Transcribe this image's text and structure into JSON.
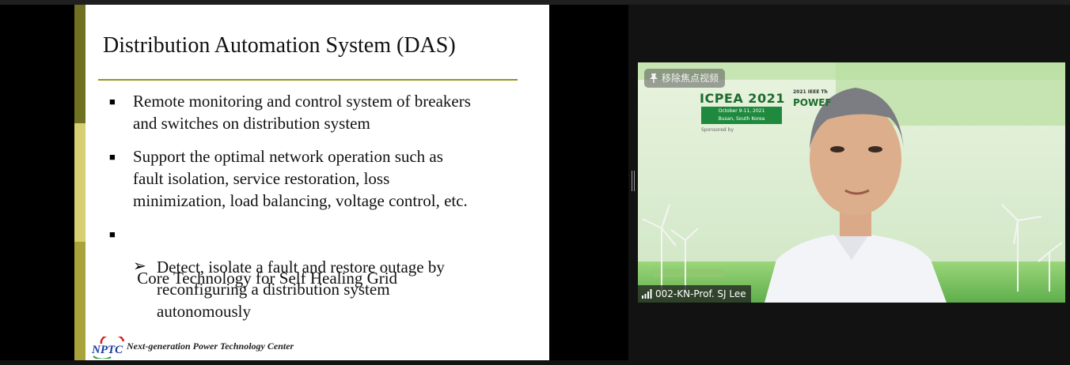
{
  "slide": {
    "title": "Distribution Automation System (DAS)",
    "bullets": [
      {
        "lines": [
          "Remote monitoring and control system of breakers",
          "and switches on distribution system"
        ]
      },
      {
        "lines": [
          "Support the optimal network operation such as",
          "fault isolation, service restoration, loss",
          "minimization, load balancing, voltage control, etc."
        ]
      },
      {
        "lines": [
          " Core Technology for Self Healing Grid"
        ]
      }
    ],
    "subbullet": {
      "lines": [
        "Detect, isolate a fault and restore outage by",
        "reconfiguring a distribution system",
        "autonomously"
      ]
    },
    "footer_text": "Next-generation Power Technology Center",
    "logo_text": "NPTC",
    "bullet_glyph": "■",
    "arrow_glyph": "➢",
    "colors": {
      "stripe_dark": "#6f7022",
      "stripe_light": "#d6cf74",
      "stripe_mid": "#a8a33a",
      "rule": "#9a9420"
    }
  },
  "video": {
    "unpin_label": "移除焦点视频",
    "participant_name": "002-KN-Prof. SJ Lee",
    "banner": {
      "logo": "ICPEA 2021",
      "date_line1": "October 9-11, 2021",
      "date_line2": "Busan, South Korea",
      "sponsor": "Sponsored by",
      "small_text": "2021 IEEE Th",
      "power_text": "POWEF"
    },
    "icons": {
      "unpin": "unpin-icon",
      "signal": "signal-icon"
    }
  }
}
